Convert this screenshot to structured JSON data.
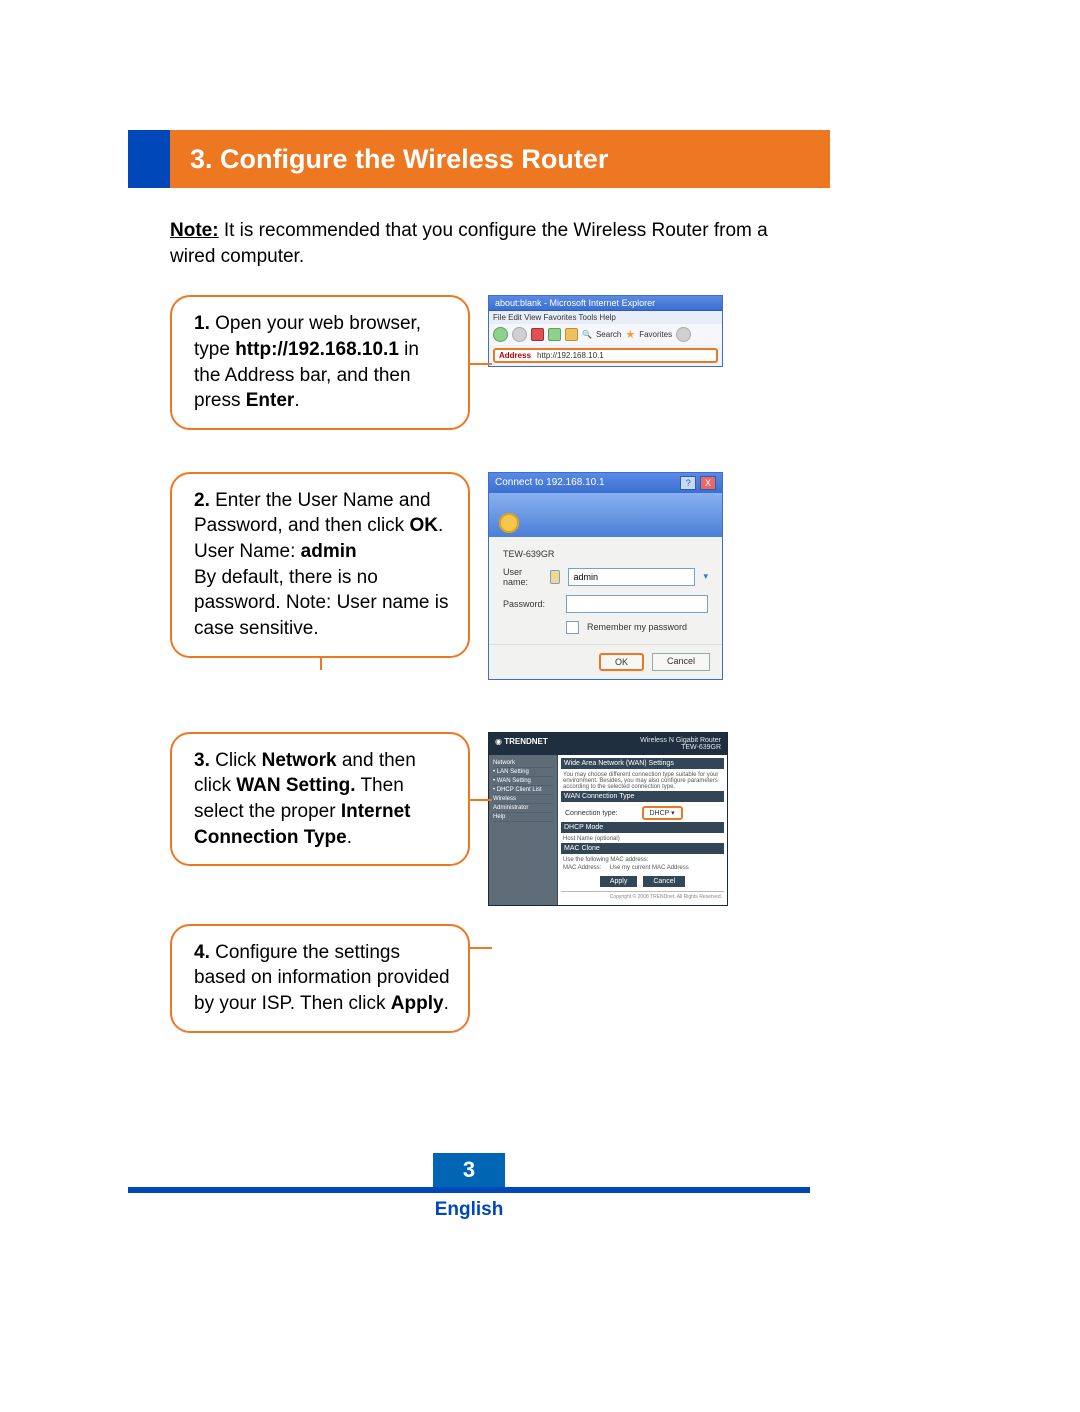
{
  "header": {
    "title": "3. Configure the Wireless Router"
  },
  "note": {
    "label": "Note:",
    "text": " It is recommended that you configure the Wireless Router from a wired computer."
  },
  "steps": {
    "s1": {
      "n": "1.",
      "t1": " Open your web browser, type ",
      "bold": "http://192.168.10.1",
      "t2": " in the Address bar, and then press ",
      "bold2": "Enter",
      "t3": "."
    },
    "s2": {
      "n": "2.",
      "t1": " Enter the User Name and Password, and then click ",
      "bold": "OK",
      "t2": ". User Name: ",
      "bold2": "admin",
      "t3": " By default, there is no password. Note: User name is case sensitive."
    },
    "s3": {
      "n": "3.",
      "t1": " Click ",
      "bold1": "Network",
      "t2": " and then click ",
      "bold2": "WAN Setting.",
      "t3": " Then select the proper ",
      "bold3": "Internet Connection Type",
      "t4": "."
    },
    "s4": {
      "n": "4.",
      "t1": " Configure the settings based on information provided by your ISP. Then click ",
      "bold": "Apply",
      "t2": "."
    }
  },
  "ie": {
    "title": "about:blank - Microsoft Internet Explorer",
    "menu": "File  Edit  View  Favorites  Tools  Help",
    "search": "Search",
    "fav": "Favorites",
    "addr_label": "Address",
    "addr_value": "http://192.168.10.1"
  },
  "login": {
    "title": "Connect to 192.168.10.1",
    "help": "?",
    "close": "X",
    "model": "TEW-639GR",
    "user_label": "User name:",
    "user_value": "admin",
    "pass_label": "Password:",
    "remember": "Remember my password",
    "ok": "OK",
    "cancel": "Cancel"
  },
  "admin": {
    "brand": "TRENDNET",
    "subtitle1": "Wireless N Gigabit Router",
    "subtitle2": "TEW-639GR",
    "side": {
      "i0": "Network",
      "i1": "• LAN Setting",
      "i2": "• WAN Setting",
      "i3": "• DHCP Client List",
      "i4": "Wireless",
      "i5": "Administrator",
      "i6": "Help"
    },
    "main": {
      "h1": "Wide Area Network (WAN) Settings",
      "desc": "You may choose different connection type suitable for your environment. Besides, you may also configure parameters according to the selected connection type.",
      "h2": "WAN Connection Type",
      "sel_label": "Connection type:",
      "sel_value": "DHCP",
      "h3": "DHCP Mode",
      "row1": "Host Name",
      "row2": "(optional)",
      "h4": "MAC Clone",
      "row3": "Use the following MAC address:",
      "row4": "MAC Address:",
      "row5": "Use my current MAC Address",
      "btn1": "Apply",
      "btn2": "Cancel",
      "foot": "Copyright © 2008 TRENDnet. All Rights Reserved."
    }
  },
  "footer": {
    "page": "3",
    "lang": "English"
  }
}
